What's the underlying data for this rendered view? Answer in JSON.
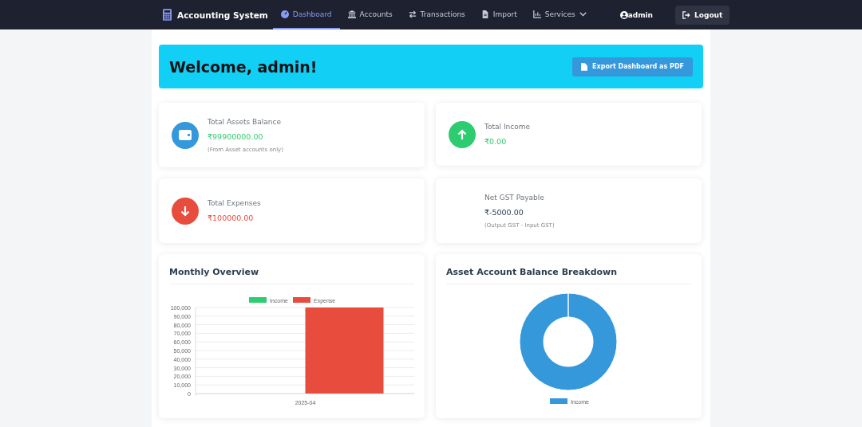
{
  "nav": {
    "brand": "Accounting System",
    "items": [
      {
        "label": "Dashboard",
        "selected": true
      },
      {
        "label": "Accounts",
        "selected": false
      },
      {
        "label": "Transactions",
        "selected": false
      },
      {
        "label": "Import",
        "selected": false
      },
      {
        "label": "Services",
        "selected": false,
        "dropdown": true
      }
    ],
    "user": "admin",
    "logout": "Logout"
  },
  "banner": {
    "title": "Welcome, admin!",
    "export_button": "Export Dashboard as PDF"
  },
  "stats": [
    {
      "title": "Total Assets Balance",
      "value": "₹99900000.00",
      "note": "(From Asset accounts only)",
      "color": "#3498db"
    },
    {
      "title": "Total Income",
      "value": "₹0.00",
      "color": "#2ecc71"
    },
    {
      "title": "Total Expenses",
      "value": "₹100000.00",
      "color": "#e74c3c"
    },
    {
      "title": "Net GST Payable",
      "value": "₹-5000.00",
      "note": "(Output GST - Input GST)"
    }
  ],
  "monthly": {
    "title": "Monthly Overview",
    "chart_data": {
      "type": "bar",
      "categories": [
        "2025-04"
      ],
      "series": [
        {
          "name": "Income",
          "color": "#2ecc71",
          "values": [
            0
          ]
        },
        {
          "name": "Expense",
          "color": "#e74c3c",
          "values": [
            100000
          ]
        }
      ],
      "ylim": [
        0,
        100000
      ],
      "grid": true,
      "yticks": [
        {
          "value": 0,
          "label": "0"
        },
        {
          "value": 10000,
          "label": "10,000"
        },
        {
          "value": 20000,
          "label": "20,000"
        },
        {
          "value": 30000,
          "label": "30,000"
        },
        {
          "value": 40000,
          "label": "40,000"
        },
        {
          "value": 50000,
          "label": "50,000"
        },
        {
          "value": 60000,
          "label": "60,000"
        },
        {
          "value": 70000,
          "label": "70,000"
        },
        {
          "value": 80000,
          "label": "80,000"
        },
        {
          "value": 90000,
          "label": "90,000"
        },
        {
          "value": 100000,
          "label": "100,000"
        }
      ]
    }
  },
  "breakdown": {
    "title": "Asset Account Balance Breakdown",
    "chart_data": {
      "type": "donut",
      "categories": [
        "Income"
      ],
      "colors": [
        "#3498db"
      ]
    }
  }
}
